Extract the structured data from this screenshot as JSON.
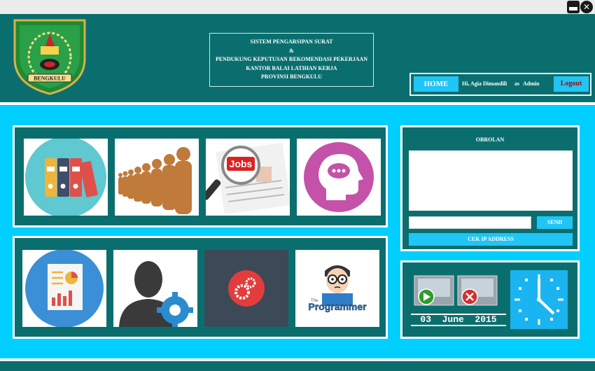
{
  "window": {
    "minimize_icon": "minimize-icon",
    "close_icon": "close-icon",
    "close_glyph": "✕"
  },
  "header": {
    "logo_text": "BENGKULU",
    "title_lines": [
      "SISTEM PENGARSIPAN SURAT",
      "&",
      "PENDUKUNG KEPUTUSAN REKOMENDASI PEKERJAAN",
      "KANTOR BALAI LATIHAN KERJA",
      "PROVINSI BENGKULU"
    ]
  },
  "nav": {
    "home_label": "HOME",
    "greeting": "Hi, Agia Dimandili",
    "as_label": "as",
    "role": "Admin",
    "logout_label": "Logout"
  },
  "menu": {
    "row1": [
      {
        "icon": "archive-binders-icon"
      },
      {
        "icon": "people-queue-icon"
      },
      {
        "icon": "job-search-icon",
        "text": "Jobs"
      },
      {
        "icon": "head-chat-icon"
      }
    ],
    "row2": [
      {
        "icon": "report-document-icon"
      },
      {
        "icon": "user-settings-icon"
      },
      {
        "icon": "settings-gears-icon"
      },
      {
        "icon": "programmer-icon",
        "text_small": "The",
        "text": "Programmer"
      }
    ]
  },
  "chat": {
    "title": "OBROLAN",
    "input_placeholder": "",
    "send_label": "SEND",
    "cek_ip_label": "CEK IP ADDRESS"
  },
  "clock": {
    "date": "03  June  2015",
    "play_icon": "play-icon",
    "stop_icon": "stop-icon",
    "clock_icon": "clock-icon"
  },
  "colors": {
    "header_teal": "#0b6e6e",
    "main_cyan": "#00cfff",
    "button_blue": "#21c5f5",
    "logout_text": "#8a1010"
  }
}
